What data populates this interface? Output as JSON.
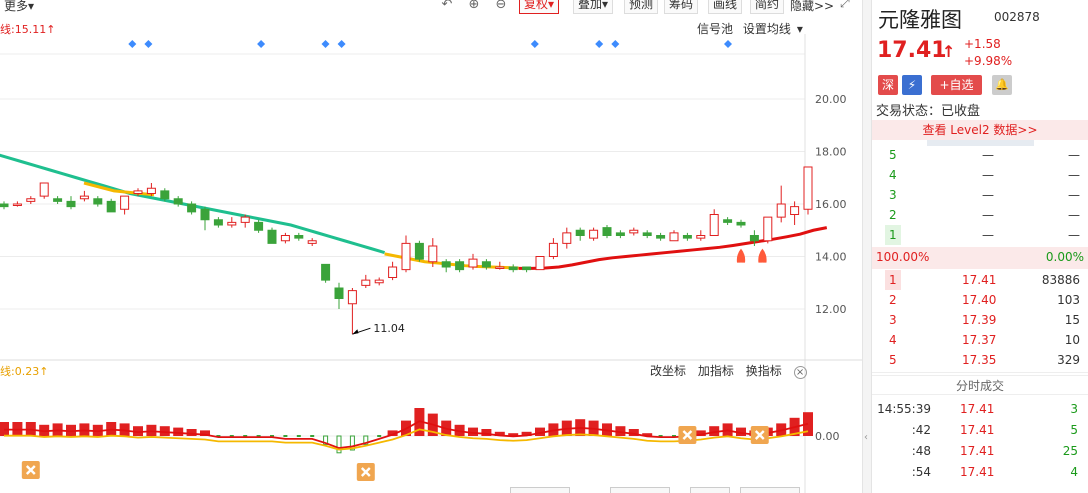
{
  "toolbar": {
    "more_label": "更多",
    "buttons": [
      "复权",
      "叠加",
      "预测",
      "筹码",
      "画线",
      "简约"
    ],
    "hide_label": "隐藏>>",
    "undo_icon": "undo-icon",
    "zoom_in_icon": "zoom-in-icon",
    "zoom_out_icon": "zoom-out-icon"
  },
  "chart": {
    "ma_label": "线:15.11",
    "links": [
      "信号池",
      "设置均线"
    ],
    "indicator_label": "线:0.23",
    "indicator_links": [
      "改坐标",
      "加指标",
      "换指标"
    ],
    "low_annotation": "11.04",
    "colors": {
      "up": "#e02020",
      "down": "#3aa33a",
      "ma_green": "#1fbf8f",
      "ma_yellow": "#f5b800",
      "ma_red": "#e01010",
      "signal": "#3d8bfd"
    }
  },
  "chart_data": {
    "type": "candlestick",
    "y_ticks": [
      "20.00",
      "18.00",
      "16.00",
      "14.00",
      "12.00"
    ],
    "ylim": [
      10.6,
      20.4
    ],
    "indicator_ticks": [
      "0.00"
    ],
    "candles": [
      {
        "o": 16.0,
        "c": 15.9,
        "h": 16.1,
        "l": 15.8
      },
      {
        "o": 16.0,
        "c": 16.0,
        "h": 16.1,
        "l": 15.9
      },
      {
        "o": 16.1,
        "c": 16.2,
        "h": 16.3,
        "l": 16.0
      },
      {
        "o": 16.3,
        "c": 16.8,
        "h": 16.8,
        "l": 16.2
      },
      {
        "o": 16.2,
        "c": 16.1,
        "h": 16.3,
        "l": 16.0
      },
      {
        "o": 16.1,
        "c": 15.9,
        "h": 16.3,
        "l": 15.8
      },
      {
        "o": 16.2,
        "c": 16.3,
        "h": 16.5,
        "l": 16.1
      },
      {
        "o": 16.2,
        "c": 16.0,
        "h": 16.3,
        "l": 15.9
      },
      {
        "o": 16.1,
        "c": 15.7,
        "h": 16.2,
        "l": 15.7
      },
      {
        "o": 15.8,
        "c": 16.3,
        "h": 16.3,
        "l": 15.6
      },
      {
        "o": 16.4,
        "c": 16.5,
        "h": 16.6,
        "l": 16.3
      },
      {
        "o": 16.4,
        "c": 16.6,
        "h": 16.8,
        "l": 16.3
      },
      {
        "o": 16.5,
        "c": 16.2,
        "h": 16.6,
        "l": 16.1
      },
      {
        "o": 16.2,
        "c": 16.0,
        "h": 16.3,
        "l": 15.9
      },
      {
        "o": 16.0,
        "c": 15.7,
        "h": 16.1,
        "l": 15.6
      },
      {
        "o": 15.8,
        "c": 15.4,
        "h": 15.9,
        "l": 15.0
      },
      {
        "o": 15.4,
        "c": 15.2,
        "h": 15.5,
        "l": 15.1
      },
      {
        "o": 15.2,
        "c": 15.3,
        "h": 15.5,
        "l": 15.1
      },
      {
        "o": 15.3,
        "c": 15.5,
        "h": 15.6,
        "l": 15.1
      },
      {
        "o": 15.3,
        "c": 15.0,
        "h": 15.4,
        "l": 14.9
      },
      {
        "o": 15.0,
        "c": 14.5,
        "h": 15.1,
        "l": 14.5
      },
      {
        "o": 14.6,
        "c": 14.8,
        "h": 14.9,
        "l": 14.5
      },
      {
        "o": 14.8,
        "c": 14.7,
        "h": 14.9,
        "l": 14.6
      },
      {
        "o": 14.5,
        "c": 14.6,
        "h": 14.7,
        "l": 14.4
      },
      {
        "o": 13.7,
        "c": 13.1,
        "h": 13.7,
        "l": 13.0
      },
      {
        "o": 12.8,
        "c": 12.4,
        "h": 13.0,
        "l": 12.0
      },
      {
        "o": 12.2,
        "c": 12.7,
        "h": 12.8,
        "l": 11.04
      },
      {
        "o": 12.9,
        "c": 13.1,
        "h": 13.3,
        "l": 12.8
      },
      {
        "o": 13.0,
        "c": 13.1,
        "h": 13.2,
        "l": 12.9
      },
      {
        "o": 13.2,
        "c": 13.6,
        "h": 13.8,
        "l": 13.1
      },
      {
        "o": 13.5,
        "c": 14.5,
        "h": 14.8,
        "l": 13.4
      },
      {
        "o": 14.5,
        "c": 13.9,
        "h": 14.6,
        "l": 13.8
      },
      {
        "o": 13.8,
        "c": 14.4,
        "h": 14.7,
        "l": 13.6
      },
      {
        "o": 13.8,
        "c": 13.6,
        "h": 13.9,
        "l": 13.4
      },
      {
        "o": 13.8,
        "c": 13.5,
        "h": 13.9,
        "l": 13.4
      },
      {
        "o": 13.6,
        "c": 13.9,
        "h": 14.1,
        "l": 13.5
      },
      {
        "o": 13.8,
        "c": 13.6,
        "h": 13.9,
        "l": 13.5
      },
      {
        "o": 13.6,
        "c": 13.6,
        "h": 13.8,
        "l": 13.5
      },
      {
        "o": 13.6,
        "c": 13.5,
        "h": 13.7,
        "l": 13.4
      },
      {
        "o": 13.6,
        "c": 13.5,
        "h": 13.6,
        "l": 13.4
      },
      {
        "o": 13.5,
        "c": 14.0,
        "h": 14.0,
        "l": 13.5
      },
      {
        "o": 14.0,
        "c": 14.5,
        "h": 14.7,
        "l": 13.9
      },
      {
        "o": 14.5,
        "c": 14.9,
        "h": 15.1,
        "l": 14.3
      },
      {
        "o": 15.0,
        "c": 14.8,
        "h": 15.1,
        "l": 14.6
      },
      {
        "o": 14.7,
        "c": 15.0,
        "h": 15.1,
        "l": 14.6
      },
      {
        "o": 15.1,
        "c": 14.8,
        "h": 15.2,
        "l": 14.7
      },
      {
        "o": 14.9,
        "c": 14.8,
        "h": 15.0,
        "l": 14.7
      },
      {
        "o": 14.9,
        "c": 15.0,
        "h": 15.1,
        "l": 14.8
      },
      {
        "o": 14.9,
        "c": 14.8,
        "h": 15.0,
        "l": 14.7
      },
      {
        "o": 14.8,
        "c": 14.7,
        "h": 14.9,
        "l": 14.6
      },
      {
        "o": 14.6,
        "c": 14.9,
        "h": 15.0,
        "l": 14.6
      },
      {
        "o": 14.8,
        "c": 14.7,
        "h": 14.9,
        "l": 14.6
      },
      {
        "o": 14.7,
        "c": 14.8,
        "h": 15.0,
        "l": 14.6
      },
      {
        "o": 14.8,
        "c": 15.6,
        "h": 15.8,
        "l": 14.8
      },
      {
        "o": 15.4,
        "c": 15.3,
        "h": 15.5,
        "l": 15.2
      },
      {
        "o": 15.3,
        "c": 15.2,
        "h": 15.4,
        "l": 15.1
      },
      {
        "o": 14.8,
        "c": 14.6,
        "h": 15.0,
        "l": 14.4
      },
      {
        "o": 14.6,
        "c": 15.5,
        "h": 15.5,
        "l": 14.5
      },
      {
        "o": 15.5,
        "c": 16.0,
        "h": 16.7,
        "l": 15.3
      },
      {
        "o": 15.6,
        "c": 15.9,
        "h": 16.1,
        "l": 15.2
      },
      {
        "o": 15.8,
        "c": 17.41,
        "h": 17.41,
        "l": 15.6
      }
    ],
    "ma_green": [
      17.9,
      17.75,
      17.6,
      17.45,
      17.3,
      17.15,
      17.0,
      16.85,
      16.7,
      16.55,
      16.4,
      16.3,
      16.2,
      16.1,
      16.0,
      15.9,
      15.8,
      15.7,
      15.6,
      15.5,
      15.4,
      15.3,
      15.2,
      15.05,
      14.9,
      14.75,
      14.6,
      14.45,
      14.3,
      14.15
    ],
    "ma_yellow": [
      14.1,
      14.0,
      13.9,
      13.8,
      13.75,
      13.7,
      13.65,
      13.62,
      13.6,
      13.58,
      13.56
    ],
    "ma_red": [
      13.55,
      13.55,
      13.56,
      13.6,
      13.68,
      13.78,
      13.88,
      13.95,
      14.0,
      14.05,
      14.1,
      14.15,
      14.2,
      14.25,
      14.3,
      14.35,
      14.42,
      14.5,
      14.58,
      14.66,
      14.75,
      14.85,
      15.0,
      15.1
    ],
    "macd": [
      0.5,
      0.5,
      0.5,
      0.4,
      0.45,
      0.4,
      0.45,
      0.4,
      0.5,
      0.45,
      0.35,
      0.4,
      0.35,
      0.3,
      0.25,
      0.2,
      0.05,
      0.05,
      0.05,
      0.05,
      0.05,
      -0.05,
      -0.05,
      -0.05,
      -0.3,
      -0.6,
      -0.5,
      -0.3,
      -0.05,
      0.2,
      0.55,
      1.0,
      0.8,
      0.55,
      0.4,
      0.3,
      0.25,
      0.15,
      0.1,
      0.15,
      0.3,
      0.45,
      0.55,
      0.6,
      0.55,
      0.45,
      0.35,
      0.25,
      0.1,
      0.05,
      0.05,
      0.1,
      0.2,
      0.35,
      0.45,
      0.3,
      0.2,
      0.3,
      0.45,
      0.65,
      0.85
    ]
  },
  "signals": [
    3,
    4,
    11,
    15,
    16,
    28,
    32,
    33,
    40
  ],
  "side": {
    "name": "元隆雅图",
    "code": "002878",
    "price": "17.41",
    "change": "+1.58",
    "change_pct": "+9.98%",
    "badge_sz": "深",
    "badge_flash": "⚡",
    "add_watch": "+自选",
    "status_label": "交易状态：已收盘",
    "l2_label": "查看 Level2 数据>>",
    "asks": [
      {
        "level": "5",
        "price": "—",
        "vol": "—"
      },
      {
        "level": "4",
        "price": "—",
        "vol": "—"
      },
      {
        "level": "3",
        "price": "—",
        "vol": "—"
      },
      {
        "level": "2",
        "price": "—",
        "vol": "—"
      },
      {
        "level": "1",
        "price": "—",
        "vol": "—"
      }
    ],
    "ratio_left": "100.00%",
    "ratio_right": "0.00%",
    "bids": [
      {
        "level": "1",
        "price": "17.41",
        "vol": "83886"
      },
      {
        "level": "2",
        "price": "17.40",
        "vol": "103"
      },
      {
        "level": "3",
        "price": "17.39",
        "vol": "15"
      },
      {
        "level": "4",
        "price": "17.37",
        "vol": "10"
      },
      {
        "level": "5",
        "price": "17.35",
        "vol": "329"
      }
    ],
    "ticks_header": "分时成交",
    "ticks": [
      {
        "time": "14:55:39",
        "price": "17.41",
        "vol": "3"
      },
      {
        "time": ":42",
        "price": "17.41",
        "vol": "5"
      },
      {
        "time": ":48",
        "price": "17.41",
        "vol": "25"
      },
      {
        "time": ":54",
        "price": "17.41",
        "vol": "4"
      }
    ]
  }
}
